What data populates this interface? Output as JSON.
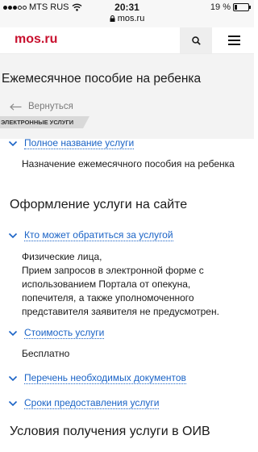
{
  "status": {
    "carrier": "MTS RUS",
    "time": "20:31",
    "url": "mos.ru",
    "battery": "19 %",
    "battery_level": 0.19
  },
  "header": {
    "logo": "mos.ru"
  },
  "page": {
    "title": "Ежемесячное пособие на ребенка",
    "back_label": "Вернуться",
    "category": "ЭЛЕКТРОННЫЕ УСЛУГИ"
  },
  "sections": {
    "full_name": {
      "label": "Полное название услуги",
      "text": "Назначение ежемесячного пособия на ребенка"
    },
    "online_heading": "Оформление услуги на сайте",
    "who": {
      "label": "Кто может обратиться за услугой",
      "lines": [
        "Физические лица,",
        "Прием запросов в электронной форме с",
        "использованием Портала от опекуна,",
        "попечителя, а также уполномоченного",
        "представителя заявителя не предусмотрен."
      ]
    },
    "cost": {
      "label": "Стоимость услуги",
      "text": "Бесплатно"
    },
    "docs": {
      "label": "Перечень необходимых документов"
    },
    "terms": {
      "label": "Сроки предоставления услуги"
    },
    "conditions_heading": "Условия получения услуги в ОИВ"
  },
  "colors": {
    "brand": "#c8102e",
    "link": "#1a63c6"
  }
}
